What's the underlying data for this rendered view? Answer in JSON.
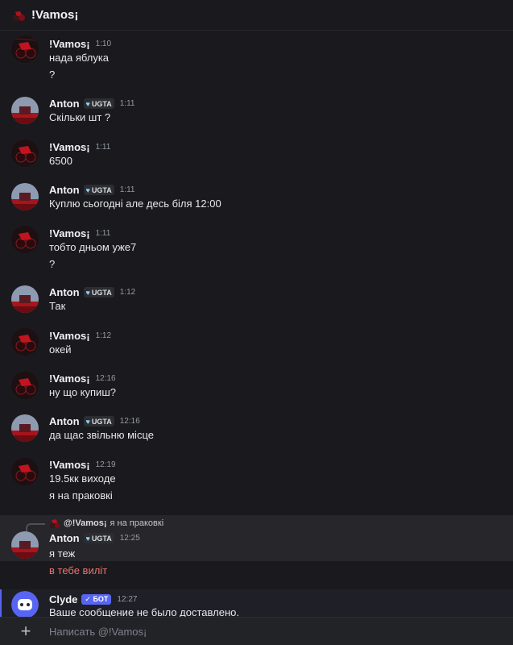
{
  "header": {
    "title": "!Vamos¡"
  },
  "users": {
    "vamos": {
      "name": "!Vamos¡"
    },
    "anton": {
      "name": "Anton",
      "tag": "UGTA"
    },
    "clyde": {
      "name": "Clyde",
      "badge": "✓ БОТ"
    }
  },
  "messages": [
    {
      "author": "!Vamos¡",
      "time": "1:10",
      "lines": [
        "нада яблука",
        "?"
      ]
    },
    {
      "author": "Anton",
      "time": "1:11",
      "lines": [
        "Скільки шт ?"
      ]
    },
    {
      "author": "!Vamos¡",
      "time": "1:11",
      "lines": [
        "6500"
      ]
    },
    {
      "author": "Anton",
      "time": "1:11",
      "lines": [
        "Куплю сьогодні але десь біля 12:00"
      ]
    },
    {
      "author": "!Vamos¡",
      "time": "1:11",
      "lines": [
        "тобто дньом уже7",
        "?"
      ]
    },
    {
      "author": "Anton",
      "time": "1:12",
      "lines": [
        "Так"
      ]
    },
    {
      "author": "!Vamos¡",
      "time": "1:12",
      "lines": [
        "окей"
      ]
    },
    {
      "author": "!Vamos¡",
      "time": "12:16",
      "lines": [
        "ну що купиш?"
      ]
    },
    {
      "author": "Anton",
      "time": "12:16",
      "lines": [
        "да щас звільню місце"
      ]
    },
    {
      "author": "!Vamos¡",
      "time": "12:19",
      "lines": [
        "19.5кк виходе",
        "я на праковкі"
      ]
    },
    {
      "author": "Anton",
      "time": "12:25",
      "reply": {
        "name": "@!Vamos¡",
        "text": "я на праковкі"
      },
      "lines": [
        "я теж",
        "в тебе виліт"
      ]
    },
    {
      "author": "Clyde",
      "time": "12:27",
      "lines": [
        "Ваше сообщение не было доставлено."
      ]
    }
  ],
  "composer": {
    "placeholder": "Написать @!Vamos¡",
    "plus": "+"
  },
  "colors": {
    "error_text": "#f0716f",
    "bot_badge": "#5865f2",
    "tag_heart": "#8fd3f4"
  }
}
